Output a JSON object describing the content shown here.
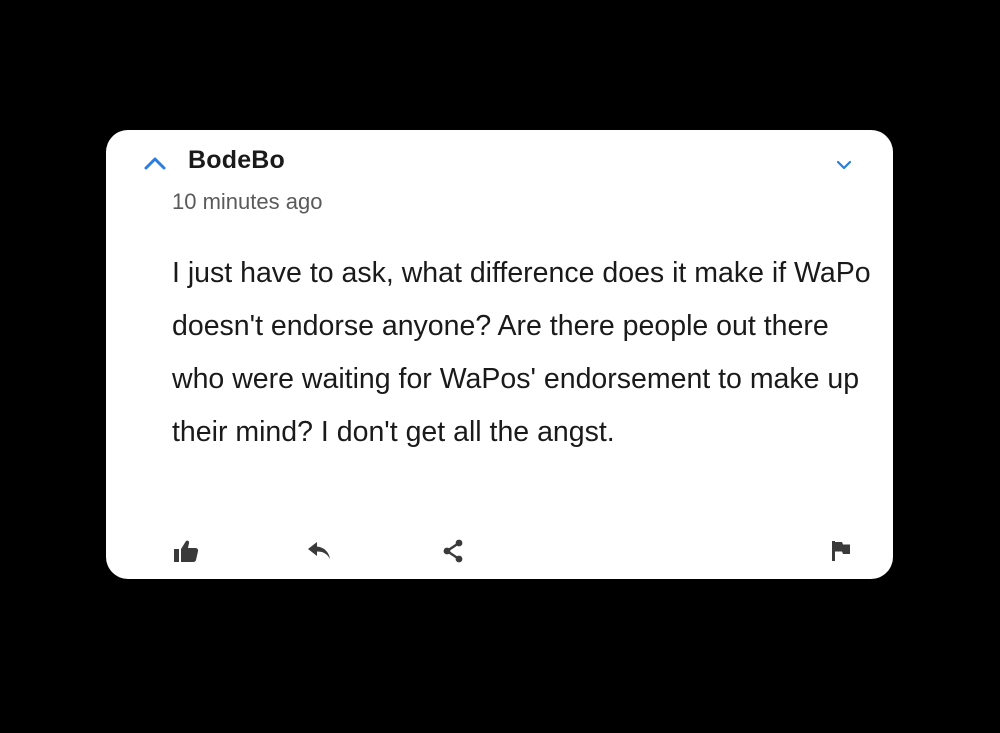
{
  "comment": {
    "author": "BodeBo",
    "timestamp": "10 minutes ago",
    "body": "I just have to ask, what difference does it make if WaPo doesn't endorse anyone? Are there people out there who were waiting for WaPos' endorsement to make up their mind? I don't get all the angst."
  },
  "icons": {
    "collapse": "chevron-up-icon",
    "menu": "chevron-down-icon",
    "like": "thumbs-up-icon",
    "reply": "reply-arrow-icon",
    "share": "share-icon",
    "flag": "flag-icon"
  },
  "colors": {
    "background": "#000000",
    "card": "#ffffff",
    "accent": "#2a7de1",
    "text": "#1a1a1a",
    "muted": "#5a5a5a",
    "icon": "#3a3a3a"
  }
}
